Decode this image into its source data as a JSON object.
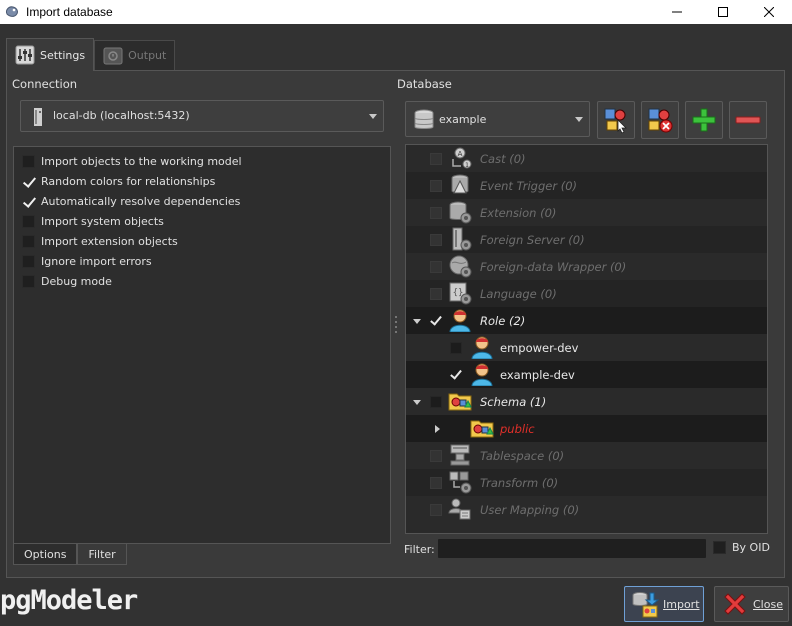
{
  "window": {
    "title": "Import database"
  },
  "tabs": [
    {
      "label": "Settings"
    },
    {
      "label": "Output"
    }
  ],
  "connection": {
    "label": "Connection",
    "selected": "local-db (localhost:5432)"
  },
  "options": [
    {
      "label": "Import objects to the working model",
      "checked": false
    },
    {
      "label": "Random colors for relationships",
      "checked": true
    },
    {
      "label": "Automatically resolve dependencies",
      "checked": true
    },
    {
      "label": "Import system objects",
      "checked": false
    },
    {
      "label": "Import extension objects",
      "checked": false
    },
    {
      "label": "Ignore import errors",
      "checked": false
    },
    {
      "label": "Debug mode",
      "checked": false
    }
  ],
  "bottom_tabs": [
    {
      "label": "Options"
    },
    {
      "label": "Filter"
    }
  ],
  "database": {
    "label": "Database",
    "selected": "example",
    "tree": [
      {
        "label": "Cast (0)",
        "icon": "cast-icon",
        "state": "disabled"
      },
      {
        "label": "Event Trigger (0)",
        "icon": "event-trigger-icon",
        "state": "disabled"
      },
      {
        "label": "Extension (0)",
        "icon": "extension-icon",
        "state": "disabled"
      },
      {
        "label": "Foreign Server (0)",
        "icon": "foreign-server-icon",
        "state": "disabled"
      },
      {
        "label": "Foreign-data Wrapper (0)",
        "icon": "foreign-data-wrapper-icon",
        "state": "disabled"
      },
      {
        "label": "Language (0)",
        "icon": "language-icon",
        "state": "disabled"
      },
      {
        "label": "Role (2)",
        "icon": "role-icon",
        "state": "expanded-checked"
      },
      {
        "label": "empower-dev",
        "icon": "user-icon",
        "state": "child-unchecked"
      },
      {
        "label": "example-dev",
        "icon": "user-icon",
        "state": "child-checked"
      },
      {
        "label": "Schema (1)",
        "icon": "schema-icon",
        "state": "expanded-unchecked"
      },
      {
        "label": "public",
        "icon": "schema-icon",
        "state": "collapsed-red"
      },
      {
        "label": "Tablespace (0)",
        "icon": "tablespace-icon",
        "state": "disabled"
      },
      {
        "label": "Transform (0)",
        "icon": "transform-icon",
        "state": "disabled"
      },
      {
        "label": "User Mapping (0)",
        "icon": "user-mapping-icon",
        "state": "disabled"
      }
    ]
  },
  "filter": {
    "label": "Filter:",
    "value": "",
    "by_oid_label": "By OID"
  },
  "brand": {
    "text": "pgModeler"
  },
  "buttons": {
    "import": "Import",
    "close": "Close"
  },
  "colors": {
    "accent_red": "#e0302a",
    "background": "#323232",
    "panel": "#3a3a3a"
  }
}
